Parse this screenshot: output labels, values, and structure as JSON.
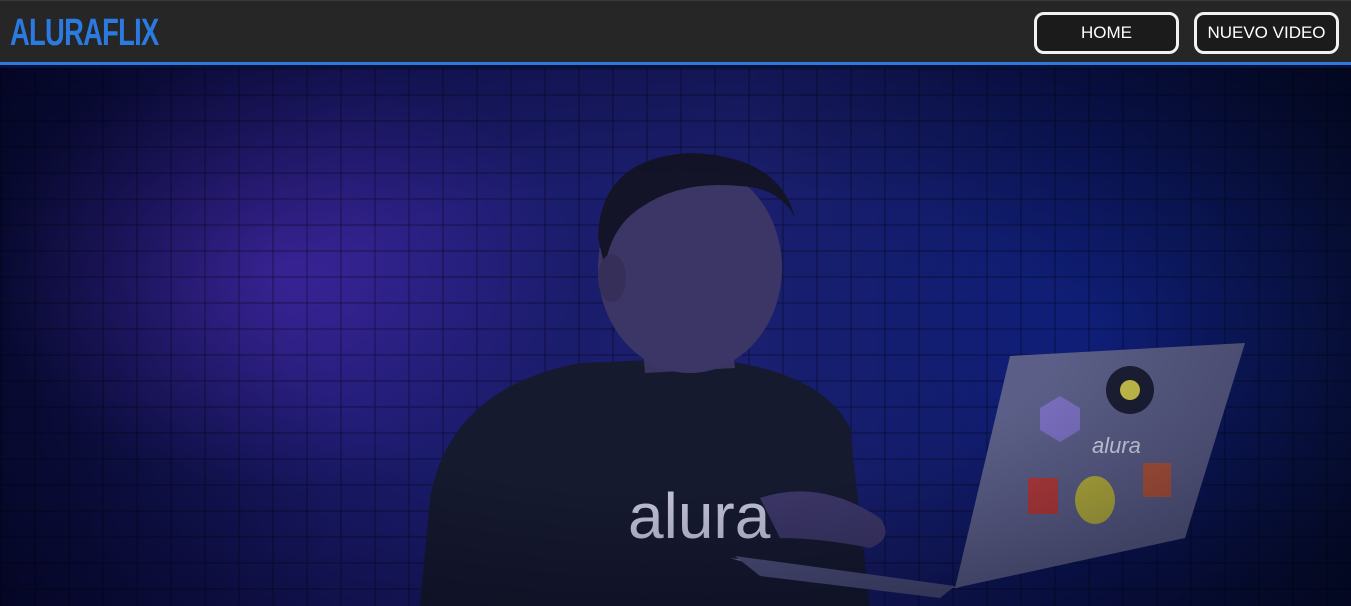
{
  "header": {
    "logo": "ALURAFLIX",
    "nav": {
      "home_label": "HOME",
      "new_video_label": "NUEVO VIDEO"
    }
  },
  "hero": {
    "shirt_text": "alura",
    "laptop_sticker_text": "alura"
  },
  "colors": {
    "accent": "#2a7ae2",
    "header_bg": "#262626",
    "hero_bg": "#1a1a6a"
  }
}
